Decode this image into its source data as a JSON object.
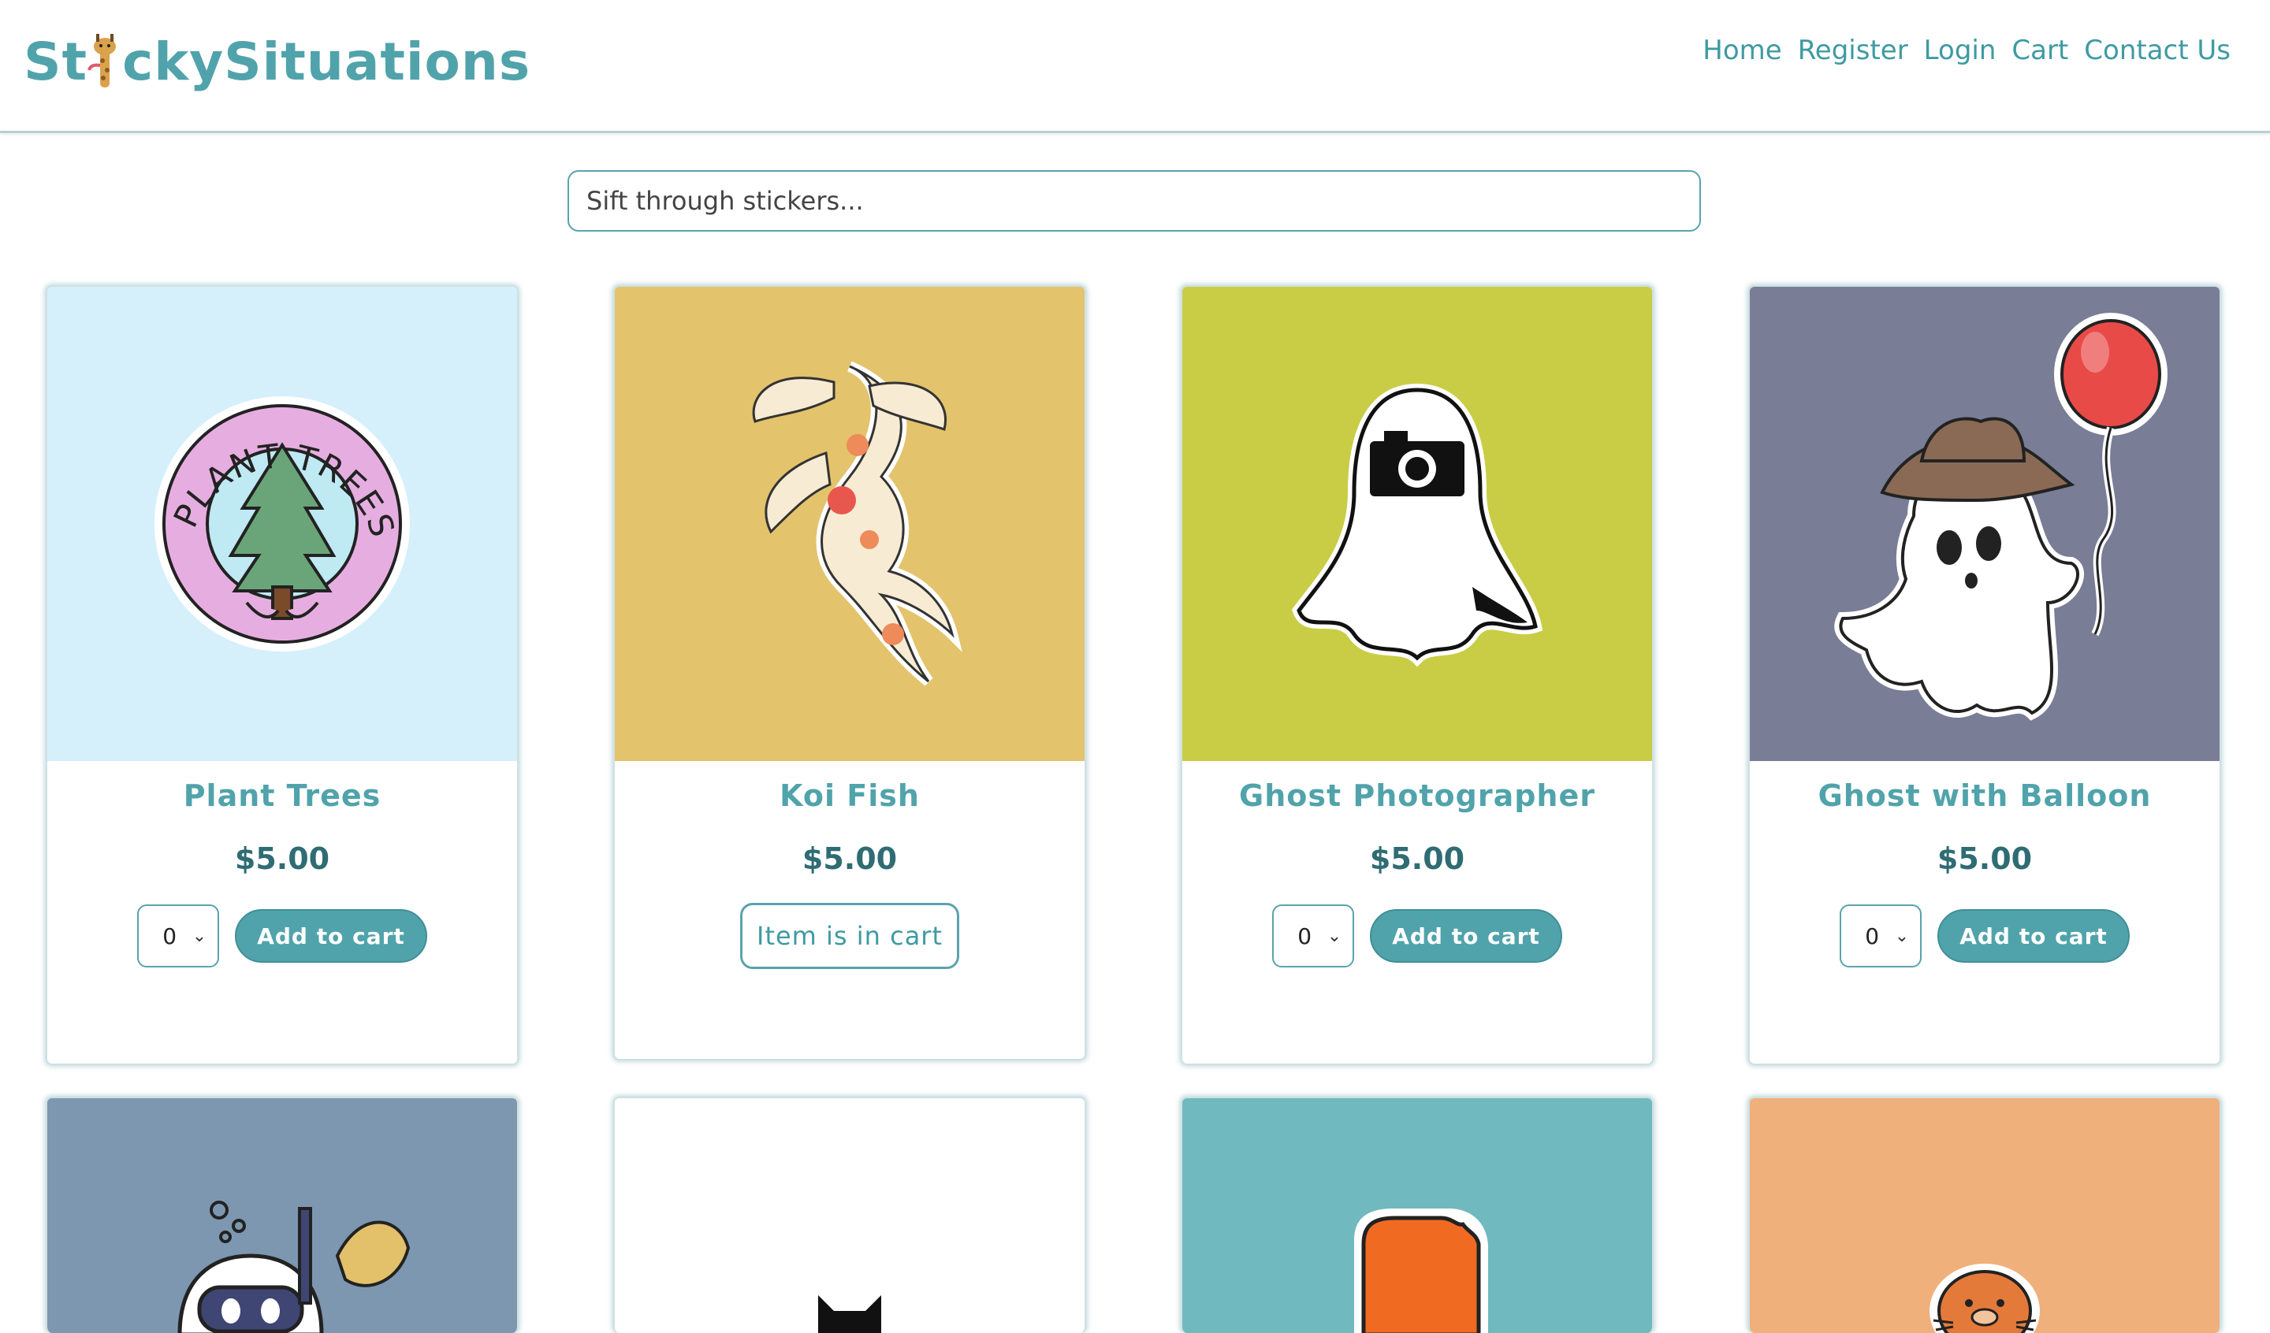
{
  "brand": {
    "name_left": "St",
    "name_right": "ckySituations",
    "accent": "#51a3ab"
  },
  "nav": {
    "home": "Home",
    "register": "Register",
    "login": "Login",
    "cart": "Cart",
    "contact": "Contact Us"
  },
  "search": {
    "placeholder": "Sift through stickers..."
  },
  "products": [
    {
      "title": "Plant Trees",
      "price": "$5.00",
      "qty": "0",
      "action": "Add to cart",
      "bg": "#d5f0fb",
      "icon": "plant-trees-sticker-icon"
    },
    {
      "title": "Koi Fish",
      "price": "$5.00",
      "action": "Item is in cart",
      "bg": "#e3c36c",
      "icon": "koi-fish-sticker-icon"
    },
    {
      "title": "Ghost Photographer",
      "price": "$5.00",
      "qty": "0",
      "action": "Add to cart",
      "bg": "#c9cd45",
      "icon": "ghost-photographer-sticker-icon"
    },
    {
      "title": "Ghost with Balloon",
      "price": "$5.00",
      "qty": "0",
      "action": "Add to cart",
      "bg": "#797d96",
      "icon": "ghost-balloon-sticker-icon"
    }
  ],
  "row2_backgrounds": [
    "#7d97b0",
    "#ffffff",
    "#70b9bf",
    "#efb07b"
  ]
}
